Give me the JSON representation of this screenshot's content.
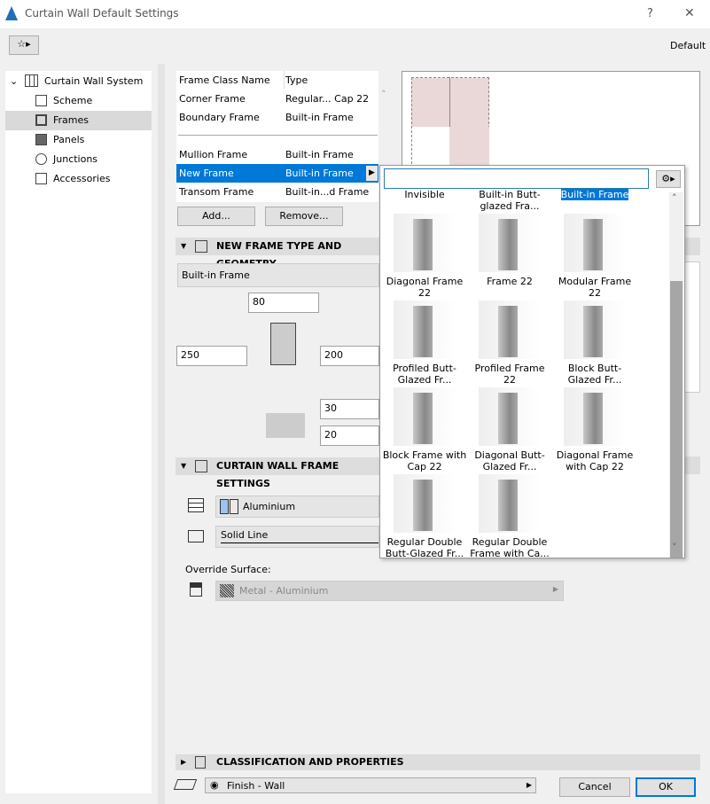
{
  "window": {
    "title": "Curtain Wall Default Settings",
    "help": "?",
    "close": "✕"
  },
  "toolbar": {
    "preset": "Default"
  },
  "tree": {
    "root": "Curtain Wall System",
    "items": [
      "Scheme",
      "Frames",
      "Panels",
      "Junctions",
      "Accessories"
    ],
    "selected": "Frames"
  },
  "frames_table": {
    "headers": [
      "Frame Class Name",
      "Type"
    ],
    "rows": [
      [
        "Corner Frame",
        "Regular... Cap 22"
      ],
      [
        "Boundary Frame",
        "Built-in Frame"
      ],
      [
        "Mullion Frame",
        "Built-in Frame"
      ],
      [
        "New Frame",
        "Built-in Frame"
      ],
      [
        "Transom Frame",
        "Built-in...d Frame"
      ]
    ],
    "selected": "New Frame",
    "add": "Add...",
    "remove": "Remove..."
  },
  "geometry": {
    "header": "NEW FRAME TYPE AND GEOMETRY",
    "type": "Built-in Frame",
    "width": "80",
    "depth_left": "250",
    "depth_right": "200",
    "offset_a": "30",
    "offset_b": "20"
  },
  "frame_settings": {
    "header": "CURTAIN WALL FRAME SETTINGS",
    "material": "Aluminium",
    "line": "Solid Line",
    "override_label": "Override Surface:",
    "surface": "Metal - Aluminium"
  },
  "popup": {
    "search": "",
    "partial_row": [
      "Invisible",
      "Built-in Butt-glazed Fra...",
      "Built-in Frame"
    ],
    "items": [
      "Diagonal Frame 22",
      "Frame 22",
      "Modular Frame 22",
      "Profiled Butt-Glazed Fr...",
      "Profiled Frame 22",
      "Block Butt-Glazed Fr...",
      "Block Frame with Cap 22",
      "Diagonal Butt-Glazed Fr...",
      "Diagonal Frame with Cap 22",
      "Regular Double Butt-Glazed Fr...",
      "Regular Double Frame with Ca..."
    ]
  },
  "classification": {
    "header": "CLASSIFICATION AND PROPERTIES"
  },
  "footer": {
    "layer": "Finish - Wall",
    "cancel": "Cancel",
    "ok": "OK"
  },
  "colors": {
    "selection": "#0078d7",
    "accent_header": "#dddddd"
  }
}
